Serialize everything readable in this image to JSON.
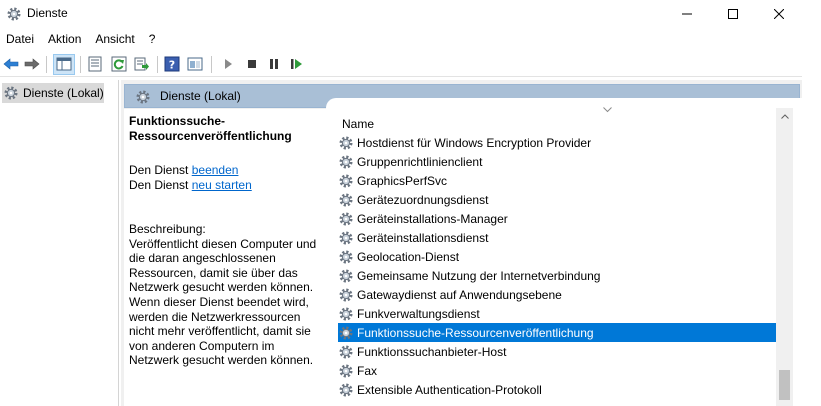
{
  "window": {
    "title": "Dienste",
    "title_icon": "gear-icon"
  },
  "menu": [
    "Datei",
    "Aktion",
    "Ansicht",
    "?"
  ],
  "tree": {
    "items": [
      {
        "label": "Dienste (Lokal)",
        "icon": "gear-icon"
      }
    ]
  },
  "pane": {
    "header": "Dienste (Lokal)",
    "service_title": "Funktionssuche-Ressourcenveröffentlichung",
    "action_prefix": "Den Dienst",
    "stop_link": "beenden",
    "restart_link": "neu starten",
    "description_label": "Beschreibung:",
    "description": "Veröffentlicht diesen Computer und die daran angeschlossenen Ressourcen, damit sie über das Netzwerk gesucht werden können. Wenn dieser Dienst beendet wird, werden die Netzwerkressourcen nicht mehr veröffentlicht, damit sie von anderen Computern im Netzwerk gesucht werden können."
  },
  "list": {
    "column_name": "Name",
    "selected_index": 10,
    "rows": [
      "Hostdienst für Windows Encryption Provider",
      "Gruppenrichtlinienclient",
      "GraphicsPerfSvc",
      "Gerätezuordnungsdienst",
      "Geräteinstallations-Manager",
      "Geräteinstallationsdienst",
      "Geolocation-Dienst",
      "Gemeinsame Nutzung der Internetverbindung",
      "Gatewaydienst auf Anwendungsebene",
      "Funkverwaltungsdienst",
      "Funktionssuche-Ressourcenveröffentlichung",
      "Funktionssuchanbieter-Host",
      "Fax",
      "Extensible Authentication-Protokoll"
    ]
  },
  "colors": {
    "selection": "#0078d7",
    "pane_header": "#a9bfd6",
    "link": "#0066cc"
  }
}
